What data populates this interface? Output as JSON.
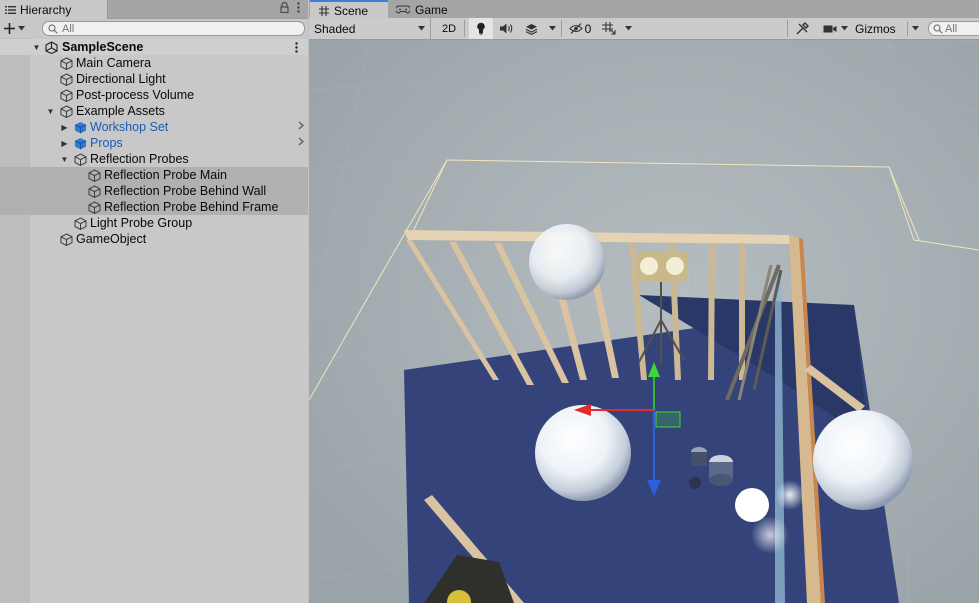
{
  "hierarchy": {
    "tab_label": "Hierarchy",
    "search_placeholder": "All",
    "rows": [
      {
        "label": "SampleScene",
        "style": "bold"
      },
      {
        "label": "Main Camera"
      },
      {
        "label": "Directional Light"
      },
      {
        "label": "Post-process Volume"
      },
      {
        "label": "Example Assets"
      },
      {
        "label": "Workshop Set",
        "style": "blue"
      },
      {
        "label": "Props",
        "style": "blue"
      },
      {
        "label": "Reflection Probes"
      },
      {
        "label": "Reflection Probe Main"
      },
      {
        "label": "Reflection Probe Behind Wall"
      },
      {
        "label": "Reflection Probe Behind Frame"
      },
      {
        "label": "Light Probe Group"
      },
      {
        "label": "GameObject"
      }
    ]
  },
  "scene": {
    "tabs": [
      "Scene",
      "Game"
    ],
    "shading_mode": "Shaded",
    "mode_2d": "2D",
    "hidden_count": "0",
    "gizmos_label": "Gizmos",
    "search_placeholder": "All"
  },
  "colors": {
    "accent": "#3b7de0",
    "prefab_blue": "#1a5bb5",
    "floor": "#34447a",
    "ground": "#a6b0b4"
  },
  "icons": [
    "hamburger-icon",
    "lock-icon",
    "kebab-menu-icon",
    "plus-icon",
    "search-icon",
    "unity-scene-icon",
    "gameobject-cube-icon",
    "prefab-cube-icon",
    "grid-icon",
    "gamepad-icon",
    "lightbulb-icon",
    "speaker-icon",
    "layers-icon",
    "eye-slash-icon",
    "grid-snap-icon",
    "tools-icon",
    "camera-icon"
  ]
}
